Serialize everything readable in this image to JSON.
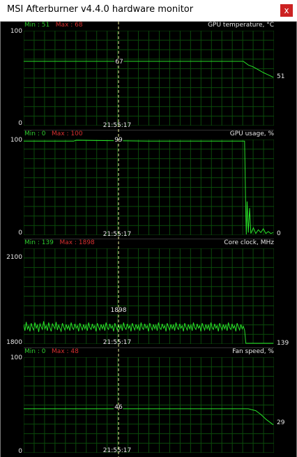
{
  "window": {
    "title": "MSI Afterburner v4.4.0 hardware monitor",
    "close_label": "x"
  },
  "cursor_time": "21:55:17",
  "colors": {
    "series": "#28e028",
    "grid": "#0b4a0b",
    "min": "#2ecc2e",
    "max": "#d83030",
    "cursor": "#f0f0a0"
  },
  "panels": [
    {
      "title": "GPU temperature, °C",
      "ymax_label": "100",
      "ymin_label": "0",
      "min_text": "Min : 51",
      "max_text": "Max : 68",
      "cursor_value": "67",
      "current_value": "51",
      "scale": [
        0,
        100
      ],
      "series": [
        [
          0,
          68
        ],
        [
          0.45,
          68
        ],
        [
          0.88,
          68
        ],
        [
          0.9,
          64
        ],
        [
          0.92,
          62
        ],
        [
          0.96,
          56
        ],
        [
          1,
          51
        ]
      ]
    },
    {
      "title": "GPU usage, %",
      "ymax_label": "100",
      "ymin_label": "0",
      "min_text": "Min : 0",
      "max_text": "Max : 100",
      "cursor_value": "99",
      "current_value": "0",
      "scale": [
        0,
        100
      ],
      "series": [
        [
          0,
          99
        ],
        [
          0.2,
          99
        ],
        [
          0.21,
          100
        ],
        [
          0.5,
          99
        ],
        [
          0.885,
          99
        ],
        [
          0.887,
          70
        ],
        [
          0.89,
          20
        ],
        [
          0.892,
          0
        ],
        [
          0.895,
          35
        ],
        [
          0.9,
          2
        ],
        [
          0.905,
          28
        ],
        [
          0.91,
          1
        ],
        [
          0.92,
          7
        ],
        [
          0.93,
          1
        ],
        [
          0.94,
          5
        ],
        [
          0.95,
          2
        ],
        [
          0.96,
          6
        ],
        [
          0.97,
          1
        ],
        [
          0.98,
          3
        ],
        [
          0.99,
          1
        ],
        [
          1,
          2
        ]
      ]
    },
    {
      "title": "Core clock, MHz",
      "ymax_label": "2100",
      "ymin_label": "1800",
      "min_text": "Min : 139",
      "max_text": "Max : 1898",
      "cursor_value": "1898",
      "current_value": "139",
      "scale": [
        1800,
        2100
      ],
      "series": [
        [
          0,
          1860
        ],
        [
          0.005,
          1840
        ],
        [
          0.01,
          1868
        ],
        [
          0.015,
          1845
        ],
        [
          0.02,
          1855
        ],
        [
          0.025,
          1838
        ],
        [
          0.03,
          1864
        ],
        [
          0.035,
          1850
        ],
        [
          0.04,
          1842
        ],
        [
          0.045,
          1866
        ],
        [
          0.05,
          1848
        ],
        [
          0.055,
          1858
        ],
        [
          0.06,
          1836
        ],
        [
          0.065,
          1862
        ],
        [
          0.07,
          1852
        ],
        [
          0.075,
          1844
        ],
        [
          0.08,
          1870
        ],
        [
          0.085,
          1846
        ],
        [
          0.09,
          1856
        ],
        [
          0.095,
          1840
        ],
        [
          0.1,
          1866
        ],
        [
          0.105,
          1850
        ],
        [
          0.11,
          1838
        ],
        [
          0.115,
          1862
        ],
        [
          0.12,
          1854
        ],
        [
          0.125,
          1846
        ],
        [
          0.13,
          1868
        ],
        [
          0.135,
          1842
        ],
        [
          0.14,
          1858
        ],
        [
          0.145,
          1848
        ],
        [
          0.15,
          1838
        ],
        [
          0.155,
          1864
        ],
        [
          0.16,
          1852
        ],
        [
          0.165,
          1842
        ],
        [
          0.17,
          1860
        ],
        [
          0.175,
          1846
        ],
        [
          0.18,
          1856
        ],
        [
          0.185,
          1840
        ],
        [
          0.19,
          1866
        ],
        [
          0.195,
          1850
        ],
        [
          0.2,
          1844
        ],
        [
          0.205,
          1862
        ],
        [
          0.21,
          1848
        ],
        [
          0.215,
          1856
        ],
        [
          0.22,
          1838
        ],
        [
          0.225,
          1864
        ],
        [
          0.23,
          1852
        ],
        [
          0.235,
          1842
        ],
        [
          0.24,
          1860
        ],
        [
          0.245,
          1846
        ],
        [
          0.25,
          1858
        ],
        [
          0.255,
          1840
        ],
        [
          0.26,
          1866
        ],
        [
          0.265,
          1850
        ],
        [
          0.27,
          1844
        ],
        [
          0.275,
          1862
        ],
        [
          0.28,
          1848
        ],
        [
          0.285,
          1856
        ],
        [
          0.29,
          1838
        ],
        [
          0.295,
          1864
        ],
        [
          0.3,
          1852
        ],
        [
          0.305,
          1842
        ],
        [
          0.31,
          1860
        ],
        [
          0.315,
          1846
        ],
        [
          0.32,
          1858
        ],
        [
          0.325,
          1840
        ],
        [
          0.33,
          1866
        ],
        [
          0.335,
          1850
        ],
        [
          0.34,
          1844
        ],
        [
          0.345,
          1862
        ],
        [
          0.35,
          1848
        ],
        [
          0.355,
          1856
        ],
        [
          0.36,
          1838
        ],
        [
          0.365,
          1864
        ],
        [
          0.37,
          1852
        ],
        [
          0.375,
          1842
        ],
        [
          0.38,
          1860
        ],
        [
          0.385,
          1846
        ],
        [
          0.39,
          1858
        ],
        [
          0.395,
          1840
        ],
        [
          0.4,
          1866
        ],
        [
          0.405,
          1850
        ],
        [
          0.41,
          1844
        ],
        [
          0.415,
          1862
        ],
        [
          0.42,
          1848
        ],
        [
          0.425,
          1856
        ],
        [
          0.43,
          1838
        ],
        [
          0.435,
          1864
        ],
        [
          0.44,
          1852
        ],
        [
          0.445,
          1842
        ],
        [
          0.45,
          1860
        ],
        [
          0.455,
          1846
        ],
        [
          0.46,
          1858
        ],
        [
          0.465,
          1840
        ],
        [
          0.47,
          1866
        ],
        [
          0.475,
          1850
        ],
        [
          0.48,
          1844
        ],
        [
          0.485,
          1862
        ],
        [
          0.49,
          1848
        ],
        [
          0.495,
          1856
        ],
        [
          0.5,
          1838
        ],
        [
          0.505,
          1864
        ],
        [
          0.51,
          1852
        ],
        [
          0.515,
          1842
        ],
        [
          0.52,
          1860
        ],
        [
          0.525,
          1846
        ],
        [
          0.53,
          1858
        ],
        [
          0.535,
          1840
        ],
        [
          0.54,
          1866
        ],
        [
          0.545,
          1850
        ],
        [
          0.55,
          1844
        ],
        [
          0.555,
          1862
        ],
        [
          0.56,
          1848
        ],
        [
          0.565,
          1856
        ],
        [
          0.57,
          1838
        ],
        [
          0.575,
          1864
        ],
        [
          0.58,
          1852
        ],
        [
          0.585,
          1842
        ],
        [
          0.59,
          1860
        ],
        [
          0.595,
          1846
        ],
        [
          0.6,
          1858
        ],
        [
          0.605,
          1840
        ],
        [
          0.61,
          1866
        ],
        [
          0.615,
          1850
        ],
        [
          0.62,
          1844
        ],
        [
          0.625,
          1862
        ],
        [
          0.63,
          1848
        ],
        [
          0.635,
          1856
        ],
        [
          0.64,
          1838
        ],
        [
          0.645,
          1864
        ],
        [
          0.65,
          1852
        ],
        [
          0.655,
          1842
        ],
        [
          0.66,
          1860
        ],
        [
          0.665,
          1846
        ],
        [
          0.67,
          1858
        ],
        [
          0.675,
          1840
        ],
        [
          0.68,
          1866
        ],
        [
          0.685,
          1850
        ],
        [
          0.69,
          1844
        ],
        [
          0.695,
          1862
        ],
        [
          0.7,
          1848
        ],
        [
          0.705,
          1856
        ],
        [
          0.71,
          1838
        ],
        [
          0.715,
          1864
        ],
        [
          0.72,
          1852
        ],
        [
          0.725,
          1842
        ],
        [
          0.73,
          1860
        ],
        [
          0.735,
          1846
        ],
        [
          0.74,
          1858
        ],
        [
          0.745,
          1840
        ],
        [
          0.75,
          1866
        ],
        [
          0.755,
          1850
        ],
        [
          0.76,
          1844
        ],
        [
          0.765,
          1862
        ],
        [
          0.77,
          1848
        ],
        [
          0.775,
          1856
        ],
        [
          0.78,
          1838
        ],
        [
          0.785,
          1864
        ],
        [
          0.79,
          1852
        ],
        [
          0.795,
          1842
        ],
        [
          0.8,
          1860
        ],
        [
          0.805,
          1846
        ],
        [
          0.81,
          1858
        ],
        [
          0.815,
          1840
        ],
        [
          0.82,
          1866
        ],
        [
          0.825,
          1850
        ],
        [
          0.83,
          1844
        ],
        [
          0.835,
          1862
        ],
        [
          0.84,
          1848
        ],
        [
          0.845,
          1856
        ],
        [
          0.85,
          1838
        ],
        [
          0.855,
          1864
        ],
        [
          0.86,
          1852
        ],
        [
          0.865,
          1842
        ],
        [
          0.87,
          1860
        ],
        [
          0.875,
          1846
        ],
        [
          0.88,
          1854
        ],
        [
          0.885,
          1842
        ],
        [
          0.89,
          1795
        ],
        [
          1,
          1795
        ]
      ]
    },
    {
      "title": "Fan speed, %",
      "ymax_label": "100",
      "ymin_label": "0",
      "min_text": "Min : 0",
      "max_text": "Max : 48",
      "cursor_value": "46",
      "current_value": "29",
      "scale": [
        0,
        100
      ],
      "series": [
        [
          0,
          46
        ],
        [
          0.5,
          46
        ],
        [
          0.9,
          46
        ],
        [
          0.93,
          44
        ],
        [
          0.95,
          40
        ],
        [
          0.97,
          35
        ],
        [
          1,
          29
        ]
      ]
    }
  ]
}
